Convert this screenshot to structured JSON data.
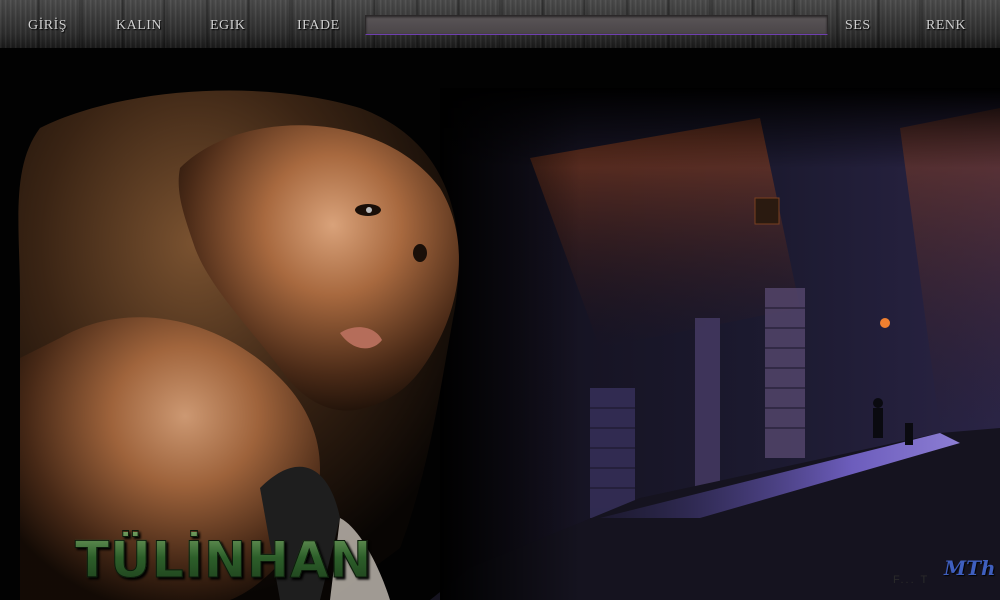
{
  "toolbar": {
    "buttons": [
      {
        "name": "toolbar-button-giris",
        "label": "GİRİŞ"
      },
      {
        "name": "toolbar-button-kalin",
        "label": "KALIN"
      },
      {
        "name": "toolbar-button-egik",
        "label": "EGIK"
      },
      {
        "name": "toolbar-button-ifade",
        "label": "IFADE"
      },
      {
        "name": "toolbar-button-ses",
        "label": "SES"
      },
      {
        "name": "toolbar-button-renk",
        "label": "RENK"
      }
    ],
    "text_value": "",
    "accent_color": "#6f3fb0"
  },
  "banner": {
    "watermark_text": "TÜLİNHAN",
    "logo_mark": "MTh",
    "corner_text": "F... T"
  },
  "colors": {
    "watermark_green": "#2f6a2c",
    "logo_blue": "#3f5fbf",
    "street_glow": "#7c6ad8",
    "warm_light": "#c0541e"
  }
}
